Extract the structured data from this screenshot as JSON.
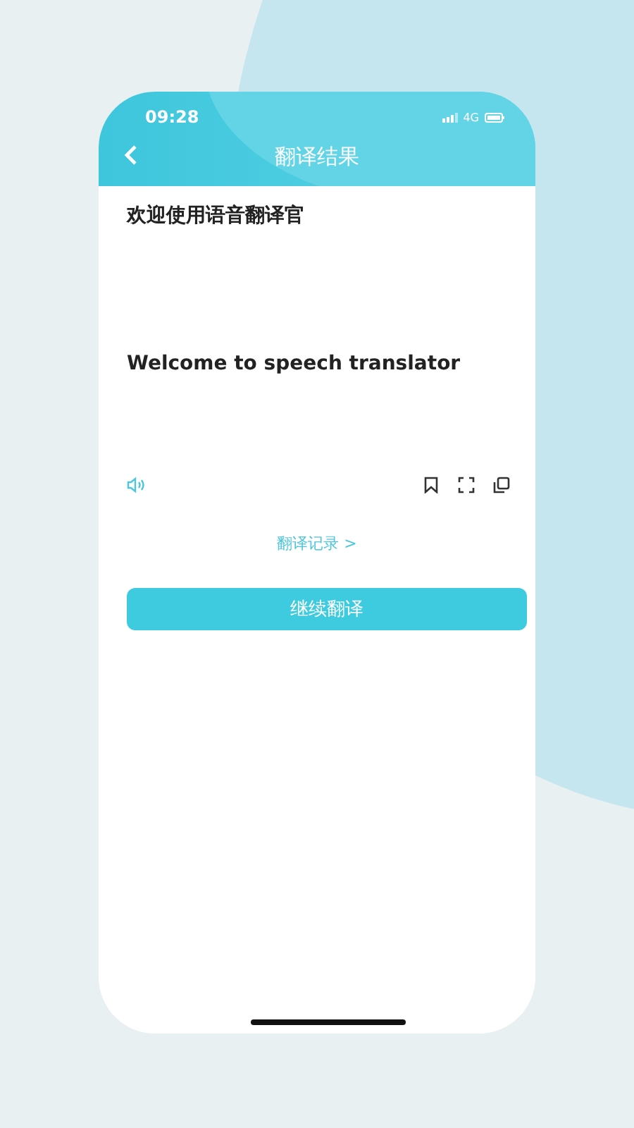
{
  "status_bar": {
    "time": "09:28",
    "network": "4G"
  },
  "header": {
    "title": "翻译结果"
  },
  "result": {
    "source_text": "欢迎使用语音翻译官",
    "translated_text": "Welcome to speech translator"
  },
  "history_link": "翻译记录 >",
  "continue_button": "继续翻译"
}
